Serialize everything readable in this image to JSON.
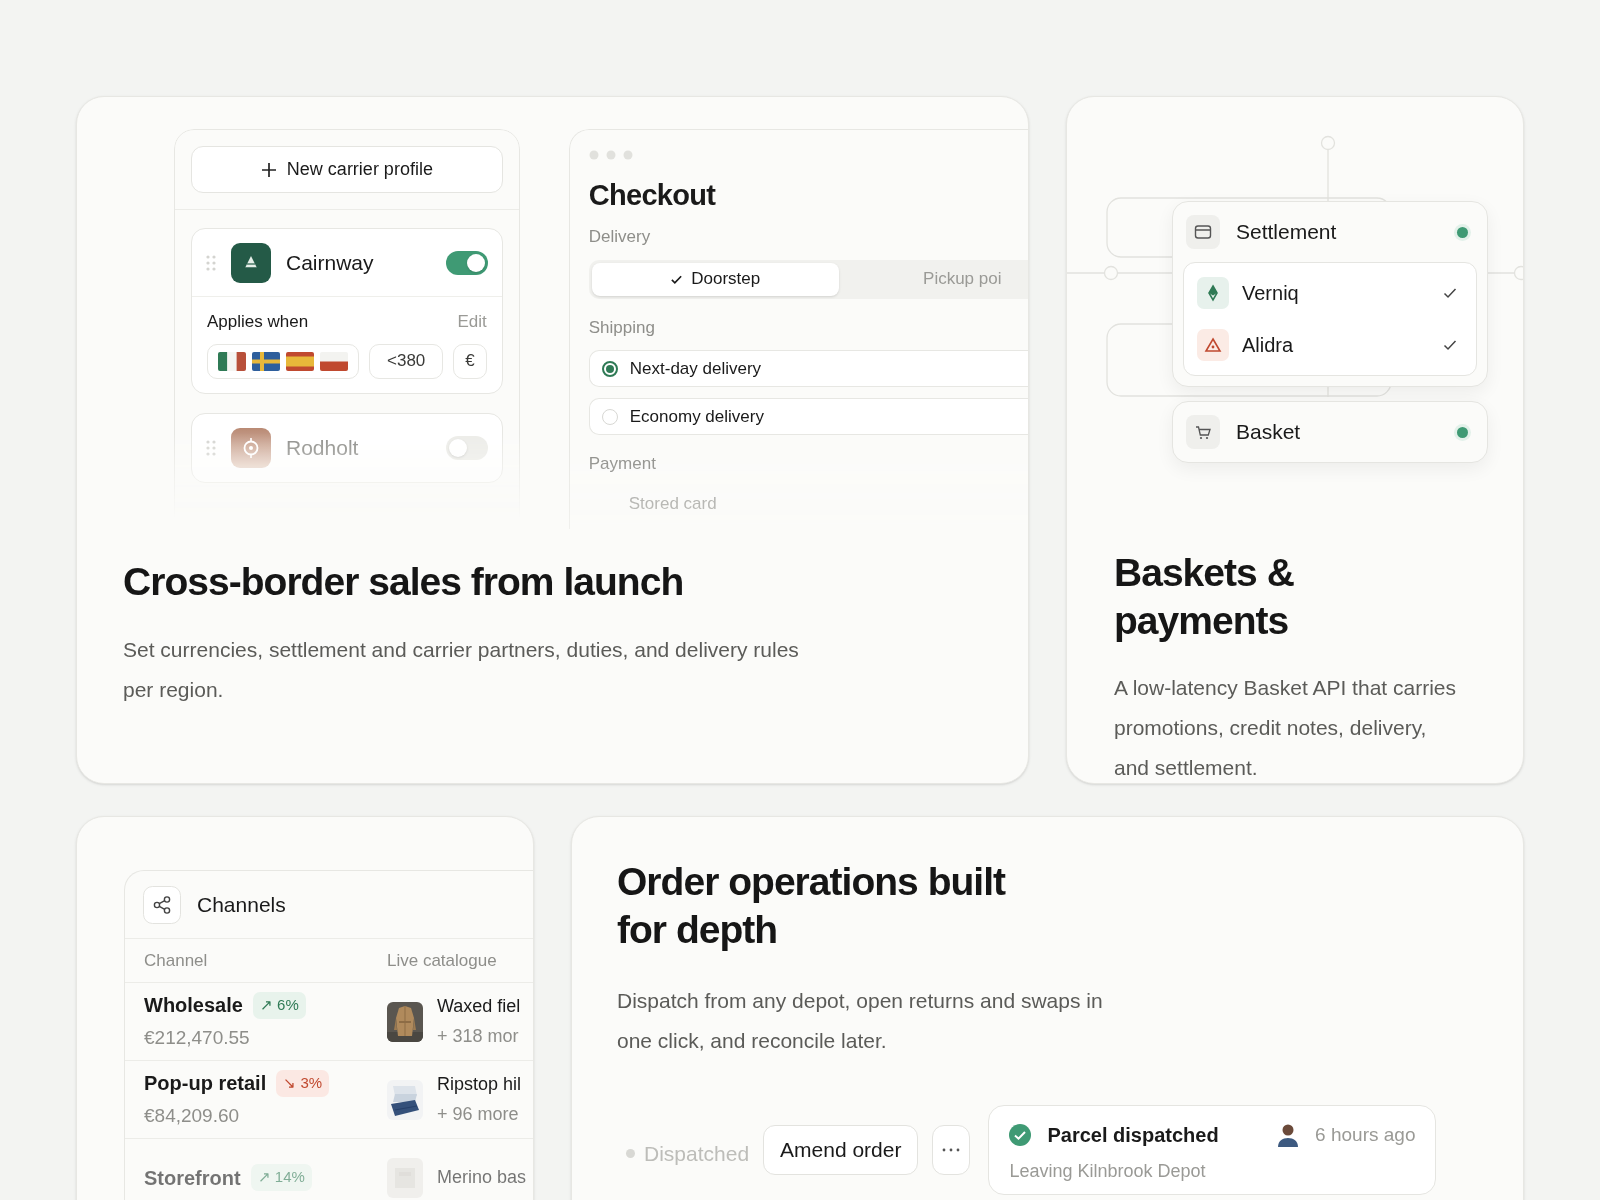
{
  "carrier_panel": {
    "new_button": "New carrier profile",
    "profiles": [
      {
        "name": "Cairnway",
        "on": true,
        "applies_label": "Applies when",
        "edit": "Edit",
        "threshold": "<380",
        "currency": "€"
      },
      {
        "name": "Rodholt",
        "on": false
      }
    ]
  },
  "checkout": {
    "title": "Checkout",
    "delivery_label": "Delivery",
    "delivery_tabs": [
      {
        "label": "Doorstep",
        "selected": true
      },
      {
        "label": "Pickup poi",
        "selected": false
      }
    ],
    "shipping_label": "Shipping",
    "shipping_options": [
      {
        "label": "Next-day delivery",
        "selected": true
      },
      {
        "label": "Economy delivery",
        "selected": false
      }
    ],
    "payment_label": "Payment",
    "payment_option": "Stored card"
  },
  "cross_border": {
    "title": "Cross-border sales from launch",
    "description": "Set currencies, settlement and carrier partners, duties, and delivery rules per region."
  },
  "flow": {
    "nodes": [
      {
        "title": "Settlement",
        "kind": "card",
        "active": true,
        "providers": [
          {
            "name": "Verniq",
            "kind": "diamond",
            "checked": true
          },
          {
            "name": "Alidra",
            "kind": "triangle",
            "checked": true
          }
        ]
      },
      {
        "title": "Basket",
        "kind": "cart",
        "active": true
      }
    ]
  },
  "baskets": {
    "title": "Baskets & payments",
    "description": "A low-latency Basket API that carries promotions, credit notes, delivery, and settlement."
  },
  "channels": {
    "title": "Channels",
    "columns": [
      "Channel",
      "Live catalogue"
    ],
    "rows": [
      {
        "name": "Wholesale",
        "kind": "rise",
        "change": "↗ 6%",
        "amount": "€212,470.55",
        "product": "Waxed fiel",
        "more": "+ 318 mor"
      },
      {
        "name": "Pop-up retail",
        "kind": "fall",
        "change": "↘ 3%",
        "amount": "€84,209.60",
        "product": "Ripstop hil",
        "more": "+ 96 more"
      },
      {
        "name": "Storefront",
        "kind": "rise",
        "change": "↗ 14%",
        "product": "Merino bas"
      }
    ]
  },
  "orders": {
    "title": "Order operations built for depth",
    "description": "Dispatch from any depot, open returns and swaps in one click, and reconcile later.",
    "timeline": {
      "status": "Dispatched",
      "action": "Amend order",
      "event": {
        "title": "Parcel dispatched",
        "time": "6 hours ago",
        "detail": "Leaving Kilnbrook Depot"
      }
    }
  }
}
